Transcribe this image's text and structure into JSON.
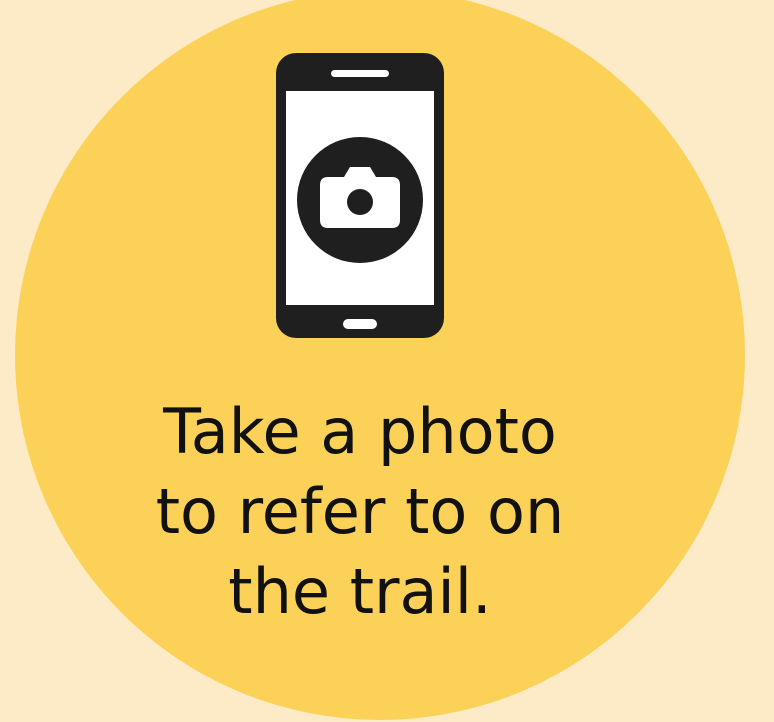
{
  "caption": {
    "line1": "Take a photo",
    "line2": "to refer to on",
    "line3": "the trail."
  },
  "colors": {
    "background": "#FDEBC7",
    "circle": "#FCD157",
    "ink": "#1F1F1F",
    "screen": "#FFFFFF"
  },
  "icons": {
    "phone": "smartphone-icon",
    "camera": "camera-icon"
  }
}
